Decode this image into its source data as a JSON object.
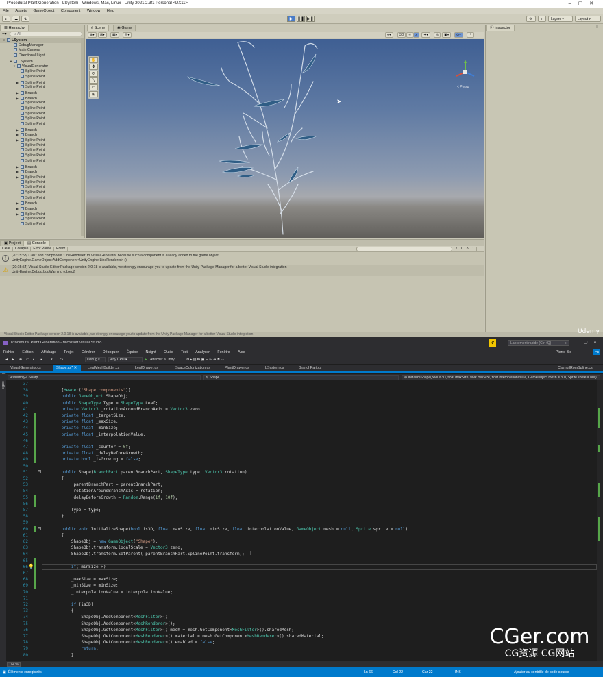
{
  "unity": {
    "title": "Procedural Plant Generation - LSystem - Windows, Mac, Linux - Unity 2021.2.3f1 Personal <DX11>",
    "menu": [
      "File",
      "Assets",
      "GameObject",
      "Component",
      "Window",
      "Help"
    ],
    "toolbar": {
      "layers": "Layers",
      "layout": "Layout"
    },
    "hierarchy": {
      "tab": "Hierarchy",
      "search_placeholder": "All",
      "items": [
        {
          "label": "LSystem",
          "indent": 0,
          "tri": "▼",
          "icon": true
        },
        {
          "label": "DebugManager",
          "indent": 2,
          "tri": "",
          "icon": true
        },
        {
          "label": "Main Camera",
          "indent": 2,
          "tri": "",
          "icon": true
        },
        {
          "label": "Directional Light",
          "indent": 2,
          "tri": "",
          "icon": true
        },
        {
          "label": "LSystem",
          "indent": 2,
          "tri": "▼",
          "icon": true
        },
        {
          "label": "VisualGenerator",
          "indent": 3,
          "tri": "▼",
          "icon": true
        },
        {
          "label": "Spline Point",
          "indent": 4,
          "tri": "",
          "icon": true
        },
        {
          "label": "Spline Point",
          "indent": 4,
          "tri": "",
          "icon": true
        },
        {
          "label": "Spline Point",
          "indent": 4,
          "tri": "▶",
          "icon": true
        },
        {
          "label": "Spline Point",
          "indent": 4,
          "tri": "",
          "icon": true
        },
        {
          "label": "Branch",
          "indent": 4,
          "tri": "▶",
          "icon": true
        },
        {
          "label": "Branch",
          "indent": 4,
          "tri": "▶",
          "icon": true
        },
        {
          "label": "Spline Point",
          "indent": 4,
          "tri": "",
          "icon": true
        },
        {
          "label": "Spline Point",
          "indent": 4,
          "tri": "",
          "icon": true
        },
        {
          "label": "Spline Point",
          "indent": 4,
          "tri": "",
          "icon": true
        },
        {
          "label": "Spline Point",
          "indent": 4,
          "tri": "",
          "icon": true
        },
        {
          "label": "Spline Point",
          "indent": 4,
          "tri": "",
          "icon": true
        },
        {
          "label": "Branch",
          "indent": 4,
          "tri": "▶",
          "icon": true
        },
        {
          "label": "Branch",
          "indent": 4,
          "tri": "▶",
          "icon": true
        },
        {
          "label": "Spline Point",
          "indent": 4,
          "tri": "▶",
          "icon": true
        },
        {
          "label": "Spline Point",
          "indent": 4,
          "tri": "",
          "icon": true
        },
        {
          "label": "Spline Point",
          "indent": 4,
          "tri": "",
          "icon": true
        },
        {
          "label": "Spline Point",
          "indent": 4,
          "tri": "",
          "icon": true
        },
        {
          "label": "Spline Point",
          "indent": 4,
          "tri": "",
          "icon": true
        },
        {
          "label": "Branch",
          "indent": 4,
          "tri": "▶",
          "icon": true
        },
        {
          "label": "Branch",
          "indent": 4,
          "tri": "▶",
          "icon": true
        },
        {
          "label": "Spline Point",
          "indent": 4,
          "tri": "▶",
          "icon": true
        },
        {
          "label": "Spline Point",
          "indent": 4,
          "tri": "",
          "icon": true
        },
        {
          "label": "Spline Point",
          "indent": 4,
          "tri": "",
          "icon": true
        },
        {
          "label": "Spline Point",
          "indent": 4,
          "tri": "",
          "icon": true
        },
        {
          "label": "Spline Point",
          "indent": 4,
          "tri": "",
          "icon": true
        },
        {
          "label": "Branch",
          "indent": 4,
          "tri": "▶",
          "icon": true
        },
        {
          "label": "Branch",
          "indent": 4,
          "tri": "▶",
          "icon": true
        },
        {
          "label": "Spline Point",
          "indent": 4,
          "tri": "▶",
          "icon": true
        },
        {
          "label": "Spline Point",
          "indent": 4,
          "tri": "",
          "icon": true
        },
        {
          "label": "Spline Point",
          "indent": 4,
          "tri": "",
          "icon": true
        }
      ]
    },
    "scene": {
      "tab_scene": "Scene",
      "tab_game": "Game",
      "mode_3d": "3D",
      "persp_label": "< Persp"
    },
    "inspector": {
      "tab": "Inspector"
    },
    "console": {
      "tab_project": "Project",
      "tab_console": "Console",
      "toolbar": [
        "Clear",
        "Collapse",
        "Error Pause",
        "Editor"
      ],
      "count_warn": "1",
      "count_err": "1",
      "messages": [
        {
          "line1": "[20:15:53] Can't add component 'LineRenderer' to VisualGenerator because such a component is already added to the game object!",
          "line2": "UnityEngine.GameObject:AddComponent<UnityEngine.LineRenderer> ()",
          "icon": "!"
        },
        {
          "line1": "[20:15:54] Visual Studio Editor Package version 2.0.18 is available, we strongly encourage you to update from the Unity Package Manager for a better Visual Studio integration",
          "line2": "UnityEngine.Debug:LogWarning (object)",
          "icon": "⚠"
        }
      ]
    },
    "status_bar": "Visual Studio Editor Package version 2.0.18 is available, we strongly encourage you to update from the Unity Package Manager for a better Visual Studio integration"
  },
  "vs": {
    "title": "Procedural Plant Generation - Microsoft Visual Studio",
    "quick_launch": "Lancement rapide (Ctrl+Q)",
    "user": "Pierre Bio",
    "user_badge": "PB",
    "menu": [
      "Fichier",
      "Edition",
      "Affichage",
      "Projet",
      "Générer",
      "Déboguer",
      "Équipe",
      "Nsight",
      "Outils",
      "Test",
      "Analyser",
      "Fenêtre",
      "Aide"
    ],
    "toolbar": {
      "config": "Debug",
      "platform": "Any CPU",
      "attach": "Attacher à Unity"
    },
    "doc_tabs": [
      {
        "label": "VisualGenerator.cs",
        "active": false
      },
      {
        "label": "Shape.cs*",
        "active": true
      },
      {
        "label": "LeafMeshBuilder.cs",
        "active": false
      },
      {
        "label": "LeafDrawer.cs",
        "active": false
      },
      {
        "label": "SpaceColonization.cs",
        "active": false
      },
      {
        "label": "PlantDrawer.cs",
        "active": false
      },
      {
        "label": "LSystem.cs",
        "active": false
      },
      {
        "label": "BranchPart.cs",
        "active": false
      },
      {
        "label": "CatmullRomSpline.cs",
        "active": false
      }
    ],
    "nav": {
      "project": "Assembly-CSharp",
      "class": "Shape",
      "member": "InitializeShape(bool is3D, float maxSize, float minSize, float interpolationValue, GameObject mesh = null, Sprite sprite = null)"
    },
    "side_label": "Boîte à outils",
    "zoom": "114 %",
    "status": {
      "left": "Éléments enregistrés",
      "ln": "Ln 66",
      "col": "Col 22",
      "car": "Car 22",
      "ins": "INS",
      "right": "Ajouter au contrôle de code source"
    },
    "code": [
      {
        "n": "37",
        "g": false,
        "t": []
      },
      {
        "n": "38",
        "g": false,
        "t": [
          [
            "pl",
            "    ["
          ],
          [
            "at",
            "Header"
          ],
          [
            "pl",
            "("
          ],
          [
            "st",
            "\"Shape components\""
          ],
          [
            "pl",
            ")]"
          ]
        ]
      },
      {
        "n": "39",
        "g": false,
        "t": [
          [
            "kw",
            "    public "
          ],
          [
            "ty",
            "GameObject"
          ],
          [
            "pl",
            " ShapeObj;"
          ]
        ]
      },
      {
        "n": "40",
        "g": false,
        "t": [
          [
            "kw",
            "    public "
          ],
          [
            "ty",
            "ShapeType"
          ],
          [
            "pl",
            " Type = "
          ],
          [
            "ty",
            "ShapeType"
          ],
          [
            "pl",
            ".Leaf;"
          ]
        ]
      },
      {
        "n": "41",
        "g": false,
        "t": [
          [
            "kw",
            "    private "
          ],
          [
            "ty",
            "Vector3"
          ],
          [
            "pl",
            " _rotationAroundBranchAxis = "
          ],
          [
            "ty",
            "Vector3"
          ],
          [
            "pl",
            ".zero;"
          ]
        ]
      },
      {
        "n": "42",
        "g": true,
        "t": [
          [
            "kw",
            "    private float"
          ],
          [
            "pl",
            " _targetSize;"
          ]
        ]
      },
      {
        "n": "43",
        "g": true,
        "t": [
          [
            "kw",
            "    private float"
          ],
          [
            "pl",
            " _maxSize;"
          ]
        ]
      },
      {
        "n": "44",
        "g": true,
        "t": [
          [
            "kw",
            "    private float"
          ],
          [
            "pl",
            " _minSize;"
          ]
        ]
      },
      {
        "n": "45",
        "g": true,
        "t": [
          [
            "kw",
            "    private float"
          ],
          [
            "pl",
            " _interpolationValue;"
          ]
        ]
      },
      {
        "n": "46",
        "g": true,
        "t": []
      },
      {
        "n": "47",
        "g": true,
        "t": [
          [
            "kw",
            "    private float"
          ],
          [
            "pl",
            " _counter = "
          ],
          [
            "nu",
            "0f"
          ],
          [
            "pl",
            ";"
          ]
        ]
      },
      {
        "n": "48",
        "g": true,
        "t": [
          [
            "kw",
            "    private float"
          ],
          [
            "pl",
            " _delayBeforeGrowth;"
          ]
        ]
      },
      {
        "n": "49",
        "g": true,
        "t": [
          [
            "kw",
            "    private bool"
          ],
          [
            "pl",
            " _isGrowing = "
          ],
          [
            "kw",
            "false"
          ],
          [
            "pl",
            ";"
          ]
        ]
      },
      {
        "n": "50",
        "g": false,
        "t": []
      },
      {
        "n": "51",
        "g": false,
        "t": [
          [
            "kw",
            "    public "
          ],
          [
            "pl",
            "Shape("
          ],
          [
            "ty",
            "BranchPart"
          ],
          [
            "pl",
            " parentBranchPart, "
          ],
          [
            "ty",
            "ShapeType"
          ],
          [
            "pl",
            " type, "
          ],
          [
            "ty",
            "Vector3"
          ],
          [
            "pl",
            " rotation)"
          ]
        ]
      },
      {
        "n": "52",
        "g": false,
        "t": [
          [
            "pl",
            "    {"
          ]
        ]
      },
      {
        "n": "53",
        "g": false,
        "t": [
          [
            "pl",
            "        _parentBranchPart = parentBranchPart;"
          ]
        ]
      },
      {
        "n": "54",
        "g": false,
        "t": [
          [
            "pl",
            "        _rotationAroundBranchAxis = rotation;"
          ]
        ]
      },
      {
        "n": "55",
        "g": true,
        "t": [
          [
            "pl",
            "        _delayBeforeGrowth = "
          ],
          [
            "ty",
            "Random"
          ],
          [
            "pl",
            ".Range("
          ],
          [
            "nu",
            "1f"
          ],
          [
            "pl",
            ", "
          ],
          [
            "nu",
            "10f"
          ],
          [
            "pl",
            ");"
          ]
        ]
      },
      {
        "n": "56",
        "g": true,
        "t": []
      },
      {
        "n": "57",
        "g": false,
        "t": [
          [
            "pl",
            "        Type = type;"
          ]
        ]
      },
      {
        "n": "58",
        "g": false,
        "t": [
          [
            "pl",
            "    }"
          ]
        ]
      },
      {
        "n": "59",
        "g": false,
        "t": []
      },
      {
        "n": "60",
        "g": true,
        "t": [
          [
            "kw",
            "    public void "
          ],
          [
            "pl",
            "InitializeShape("
          ],
          [
            "kw",
            "bool"
          ],
          [
            "pl",
            " is3D, "
          ],
          [
            "kw",
            "float"
          ],
          [
            "pl",
            " maxSize, "
          ],
          [
            "kw",
            "float"
          ],
          [
            "pl",
            " minSize, "
          ],
          [
            "kw",
            "float"
          ],
          [
            "pl",
            " interpolationValue, "
          ],
          [
            "ty",
            "GameObject"
          ],
          [
            "pl",
            " mesh = "
          ],
          [
            "kw",
            "null"
          ],
          [
            "pl",
            ", "
          ],
          [
            "ty",
            "Sprite"
          ],
          [
            "pl",
            " sprite = "
          ],
          [
            "kw",
            "null"
          ],
          [
            "pl",
            ")"
          ]
        ]
      },
      {
        "n": "61",
        "g": false,
        "t": [
          [
            "pl",
            "    {"
          ]
        ]
      },
      {
        "n": "62",
        "g": false,
        "t": [
          [
            "pl",
            "        ShapeObj = "
          ],
          [
            "kw",
            "new "
          ],
          [
            "ty",
            "GameObject"
          ],
          [
            "pl",
            "("
          ],
          [
            "st",
            "\"Shape\""
          ],
          [
            "pl",
            ");"
          ]
        ]
      },
      {
        "n": "63",
        "g": false,
        "t": [
          [
            "pl",
            "        ShapeObj.transform.localScale = "
          ],
          [
            "ty",
            "Vector3"
          ],
          [
            "pl",
            ".zero;"
          ]
        ]
      },
      {
        "n": "64",
        "g": false,
        "t": [
          [
            "pl",
            "        ShapeObj.transform.SetParent(_parentBranchPart.SplinePoint.transform);"
          ]
        ]
      },
      {
        "n": "65",
        "g": true,
        "t": []
      },
      {
        "n": "66",
        "g": true,
        "cur": true,
        "t": [
          [
            "kw",
            "        if"
          ],
          [
            "pl",
            "(_minSize >)"
          ]
        ]
      },
      {
        "n": "67",
        "g": true,
        "t": []
      },
      {
        "n": "68",
        "g": true,
        "t": [
          [
            "pl",
            "        _maxSize = maxSize;"
          ]
        ]
      },
      {
        "n": "69",
        "g": true,
        "t": [
          [
            "pl",
            "        _minSize = minSize;"
          ]
        ]
      },
      {
        "n": "70",
        "g": false,
        "t": [
          [
            "pl",
            "        _interpolationValue = interpolationValue;"
          ]
        ]
      },
      {
        "n": "71",
        "g": false,
        "t": []
      },
      {
        "n": "72",
        "g": false,
        "t": [
          [
            "kw",
            "        if"
          ],
          [
            "pl",
            " (is3D)"
          ]
        ]
      },
      {
        "n": "73",
        "g": false,
        "t": [
          [
            "pl",
            "        {"
          ]
        ]
      },
      {
        "n": "74",
        "g": false,
        "t": [
          [
            "pl",
            "            ShapeObj.AddComponent<"
          ],
          [
            "ty",
            "MeshFilter"
          ],
          [
            "pl",
            ">();"
          ]
        ]
      },
      {
        "n": "75",
        "g": false,
        "t": [
          [
            "pl",
            "            ShapeObj.AddComponent<"
          ],
          [
            "ty",
            "MeshRenderer"
          ],
          [
            "pl",
            ">();"
          ]
        ]
      },
      {
        "n": "76",
        "g": false,
        "t": [
          [
            "pl",
            "            ShapeObj.GetComponent<"
          ],
          [
            "ty",
            "MeshFilter"
          ],
          [
            "pl",
            ">().mesh = mesh.GetComponent<"
          ],
          [
            "ty",
            "MeshFilter"
          ],
          [
            "pl",
            ">().sharedMesh;"
          ]
        ]
      },
      {
        "n": "77",
        "g": false,
        "t": [
          [
            "pl",
            "            ShapeObj.GetComponent<"
          ],
          [
            "ty",
            "MeshRenderer"
          ],
          [
            "pl",
            ">().material = mesh.GetComponent<"
          ],
          [
            "ty",
            "MeshRenderer"
          ],
          [
            "pl",
            ">().sharedMaterial;"
          ]
        ]
      },
      {
        "n": "78",
        "g": false,
        "t": [
          [
            "pl",
            "            ShapeObj.GetComponent<"
          ],
          [
            "ty",
            "MeshRenderer"
          ],
          [
            "pl",
            ">().enabled = "
          ],
          [
            "kw",
            "false"
          ],
          [
            "pl",
            ";"
          ]
        ]
      },
      {
        "n": "79",
        "g": false,
        "t": [
          [
            "kw",
            "            return"
          ],
          [
            "pl",
            ";"
          ]
        ]
      },
      {
        "n": "80",
        "g": false,
        "t": [
          [
            "pl",
            "        }"
          ]
        ]
      }
    ]
  },
  "watermark": {
    "main": "CGer.com",
    "sub": "CG资源 CG网站"
  },
  "udemy": "Udemy",
  "colors": {
    "vs_accent": "#007acc",
    "keyword": "#569cd6",
    "type": "#4ec9b0",
    "string": "#d69d85",
    "number": "#b5cea8",
    "line_number": "#2b91af"
  }
}
